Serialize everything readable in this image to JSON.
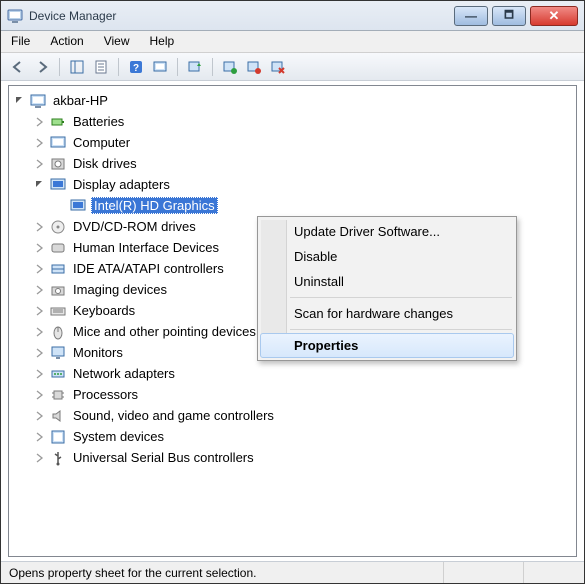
{
  "window": {
    "title": "Device Manager"
  },
  "menubar": [
    "File",
    "Action",
    "View",
    "Help"
  ],
  "tree_root": "akbar-HP",
  "categories": [
    "Batteries",
    "Computer",
    "Disk drives",
    "Display adapters",
    "DVD/CD-ROM drives",
    "Human Interface Devices",
    "IDE ATA/ATAPI controllers",
    "Imaging devices",
    "Keyboards",
    "Mice and other pointing devices",
    "Monitors",
    "Network adapters",
    "Processors",
    "Sound, video and game controllers",
    "System devices",
    "Universal Serial Bus controllers"
  ],
  "selected_device": "Intel(R) HD Graphics",
  "context_menu": {
    "items": [
      "Update Driver Software...",
      "Disable",
      "Uninstall",
      "Scan for hardware changes",
      "Properties"
    ],
    "highlighted_index": 4
  },
  "statusbar": "Opens property sheet for the current selection."
}
